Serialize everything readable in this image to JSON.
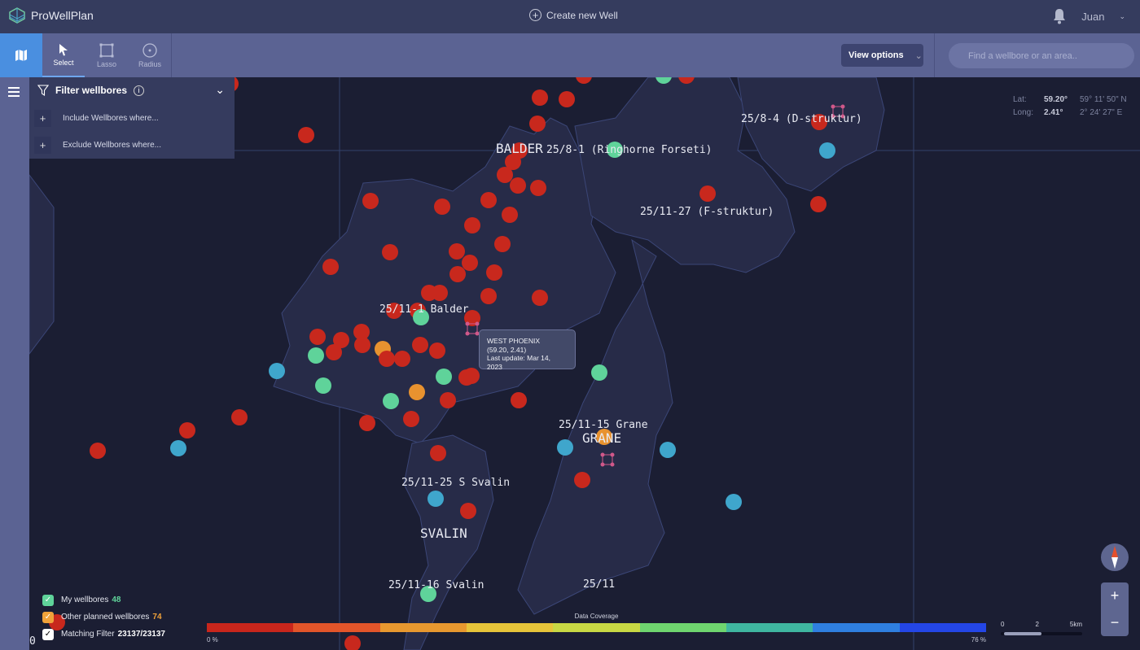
{
  "app": {
    "title": "ProWellPlan",
    "create_label": "Create new Well",
    "user": "Juan"
  },
  "toolbar": {
    "tools": [
      {
        "label": "Select",
        "icon": "cursor-icon"
      },
      {
        "label": "Lasso",
        "icon": "lasso-icon"
      },
      {
        "label": "Radius",
        "icon": "radius-icon"
      }
    ],
    "view_options": "View options",
    "search_placeholder": "Find a wellbore or an area.."
  },
  "filter": {
    "title": "Filter wellbores",
    "include": "Include Wellbores where...",
    "exclude": "Exclude Wellbores where..."
  },
  "coords": {
    "lat_label": "Lat:",
    "lat": "59.20°",
    "lat_dms": "59° 11' 50\" N",
    "long_label": "Long:",
    "long": "2.41°",
    "long_dms": "2° 24' 27\" E"
  },
  "tooltip": {
    "name": "WEST PHOENIX",
    "coords": "(59.20, 2.41)",
    "updated": "Last update: Mar 14, 2023"
  },
  "map_labels": [
    "25/8-4 (D-struktur)",
    "BALDER",
    "25/8-1 (Ringhorne Forseti)",
    "25/11-27 (F-struktur)",
    "25/11-1 Balder",
    "25/11-15 Grane",
    "GRANE",
    "25/11-25 S Svalin",
    "SVALIN",
    "25/11-16 Svalin",
    "25/11",
    "0"
  ],
  "legend": [
    {
      "label": "My wellbores",
      "count": "48",
      "color": "#5fd39a"
    },
    {
      "label": "Other planned wellbores",
      "count": "74",
      "color": "#f0a23a"
    },
    {
      "label": "Matching Filter",
      "count": "23137/23137",
      "color": "#ffffff"
    }
  ],
  "coverage": {
    "title": "Data Coverage",
    "min": "0 %",
    "max": "76 %",
    "colors": [
      "#c9261c",
      "#e2552a",
      "#e7982f",
      "#e6c43a",
      "#c8d844",
      "#6fd56f",
      "#3fb6a0",
      "#2f7fe0",
      "#2446e6"
    ]
  },
  "scale": {
    "labels": [
      "0",
      "2",
      "5km"
    ]
  },
  "colors": {
    "well_red": "#c8281d",
    "well_green": "#5fd39a",
    "well_blue": "#3fa6cc",
    "well_orange": "#e8922f",
    "accent": "#4a8fe0"
  }
}
